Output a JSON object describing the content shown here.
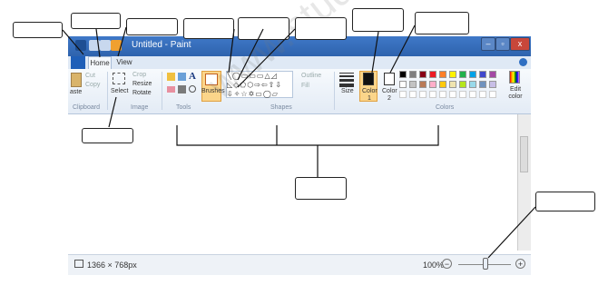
{
  "window": {
    "title": "Untitled - Paint",
    "tabs": [
      "Home",
      "View"
    ],
    "controls": {
      "minimize": "–",
      "maximize": "▫",
      "close": "x"
    }
  },
  "ribbon": {
    "clipboard": {
      "paste": "aste",
      "cut": "Cut",
      "copy": "Copy",
      "group": "Clipboard"
    },
    "image": {
      "select": "Select",
      "crop": "Crop",
      "resize": "Resize",
      "rotate": "Rotate",
      "group": "Image"
    },
    "tools": {
      "group": "Tools",
      "text_glyph": "A"
    },
    "brushes": {
      "label": "Brushes"
    },
    "shapes": {
      "outline": "Outline",
      "fill": "Fill",
      "group": "Shapes"
    },
    "size": {
      "label": "Size"
    },
    "color1": {
      "label": "Color",
      "sub": "1",
      "value": "#111111"
    },
    "color2": {
      "label": "Color",
      "sub": "2",
      "value": "#ffffff"
    },
    "colors": {
      "group": "Colors",
      "edit": "Edit color",
      "row1": [
        "#000000",
        "#7f7f7f",
        "#880015",
        "#ed1c24",
        "#ff7f27",
        "#fff200",
        "#22b14c",
        "#00a2e8",
        "#3f48cc",
        "#a349a4"
      ],
      "row2": [
        "#ffffff",
        "#c3c3c3",
        "#b97a57",
        "#ffaec9",
        "#ffc90e",
        "#efe4b0",
        "#b5e61d",
        "#99d9ea",
        "#7092be",
        "#c8bfe7"
      ]
    }
  },
  "statusbar": {
    "dimensions": "1366 × 768px",
    "zoom": "100%",
    "zoom_out": "−",
    "zoom_in": "+"
  },
  "watermark": "www.studiestoday.com"
}
